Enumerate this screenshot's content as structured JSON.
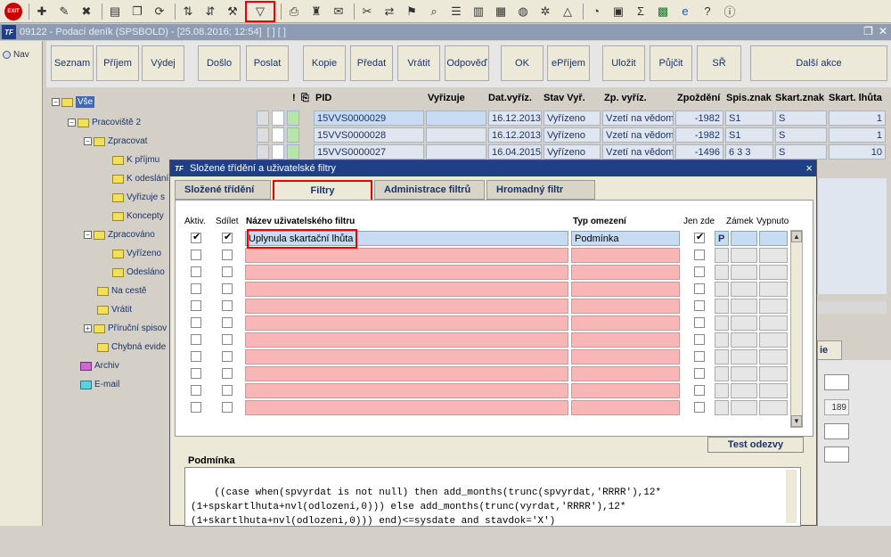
{
  "toolbar": {
    "icons": [
      "exit-icon",
      "add-document-icon",
      "edit-document-icon",
      "delete-document-icon",
      "print-list-icon",
      "copy-icon",
      "refresh-icon",
      "sort-asc-icon",
      "sort-desc-icon",
      "tools-icon",
      "filter-icon",
      "printer-icon",
      "stamp-icon",
      "mail-icon",
      "cut-icon",
      "transfer-icon",
      "route-icon",
      "search-icon",
      "list-icon",
      "columns-icon",
      "report-icon",
      "globe-icon",
      "settings-icon",
      "scale-icon",
      "stats-icon",
      "calendar-icon",
      "sigma-icon",
      "excel-icon",
      "internet-icon",
      "help-icon",
      "info-icon"
    ],
    "exit_label": "EXIT"
  },
  "window": {
    "logo": "TF",
    "title": "09122 - Podací deník (SPSBOLD) - [25.08.2016; 12:54]",
    "tags": "[ ] [ ]"
  },
  "nav": {
    "label": "Nav"
  },
  "actions": [
    {
      "label": "Seznam"
    },
    {
      "label": "Příjem"
    },
    {
      "label": "Výdej"
    },
    {
      "label": "Došlo"
    },
    {
      "label": "Poslat"
    },
    {
      "label": "Kopie"
    },
    {
      "label": "Předat"
    },
    {
      "label": "Vrátit"
    },
    {
      "label": "Odpověď"
    },
    {
      "label": "OK"
    },
    {
      "label": "ePříjem"
    },
    {
      "label": "Uložit"
    },
    {
      "label": "Půjčit"
    },
    {
      "label": "SŘ"
    },
    {
      "label": "Další akce"
    }
  ],
  "tree": {
    "root": "Vše",
    "pracoviste": "Pracoviště 2",
    "zpracovat": "Zpracovat",
    "k_prijmu": "K příjmu",
    "k_odeslani": "K odeslání",
    "vyrizuje": "Vyřizuje s",
    "koncepty": "Koncepty",
    "zpracovano": "Zpracováno",
    "vyrizeno": "Vyřízeno",
    "odeslano": "Odesláno",
    "na_ceste": "Na cestě",
    "vratit": "Vrátit",
    "prirucni": "Příruční spisov",
    "chybna": "Chybná evide",
    "archiv": "Archiv",
    "email": "E-mail"
  },
  "grid": {
    "headers": {
      "excl": "!",
      "pid": "PID",
      "vyrizuje": "Vyřizuje",
      "dat": "Dat.vyříz.",
      "stav": "Stav Vyř.",
      "zp": "Zp. vyříz.",
      "zpozdeni": "Zpoždění",
      "spis": "Spis.znak",
      "skart": "Skart.znak",
      "lhuta": "Skart. lhůta"
    },
    "rows": [
      {
        "pid": "15VVS0000029",
        "dat": "16.12.2013",
        "stav": "Vyřízeno",
        "zp": "Vzetí na vědom",
        "zpozdeni": "-1982",
        "spis": "S1",
        "skart": "S",
        "lhuta": "1"
      },
      {
        "pid": "15VVS0000028",
        "dat": "16.12.2013",
        "stav": "Vyřízeno",
        "zp": "Vzetí na vědom",
        "zpozdeni": "-1982",
        "spis": "S1",
        "skart": "S",
        "lhuta": "1"
      },
      {
        "pid": "15VVS0000027",
        "dat": "16.04.2015",
        "stav": "Vyřízeno",
        "zp": "Vzetí na vědom",
        "zpozdeni": "-1496",
        "spis": "6 3 3",
        "skart": "S",
        "lhuta": "10"
      }
    ],
    "side_value": "189",
    "side_tab": "ie"
  },
  "dialog": {
    "logo": "TF",
    "title": "Složené třídění a uživatelské filtry",
    "close": "×",
    "tabs": [
      {
        "label": "Složené třídění"
      },
      {
        "label": "Filtry"
      },
      {
        "label": "Administrace filtrů"
      },
      {
        "label": "Hromadný filtr"
      }
    ],
    "columns": {
      "aktiv": "Aktiv.",
      "sdilet": "Sdílet",
      "name": "Název uživatelského filtru",
      "typ": "Typ omezení",
      "jenzde": "Jen zde",
      "zamek": "Zámek",
      "vypnuto": "Vypnuto"
    },
    "filter": {
      "name": "Uplynula skartační lhůta",
      "type": "Podmínka",
      "lock": "P"
    },
    "test_button": "Test odezvy",
    "condition_label": "Podmínka",
    "condition": "((case when(spvyrdat is not null) then add_months(trunc(spvyrdat,'RRRR'),12*(1+spskartlhuta+nvl(odlozeni,0))) else add_months(trunc(vyrdat,'RRRR'),12*(1+skartlhuta+nvl(odlozeni,0))) end)<=sysdate and stavdok='X')"
  }
}
